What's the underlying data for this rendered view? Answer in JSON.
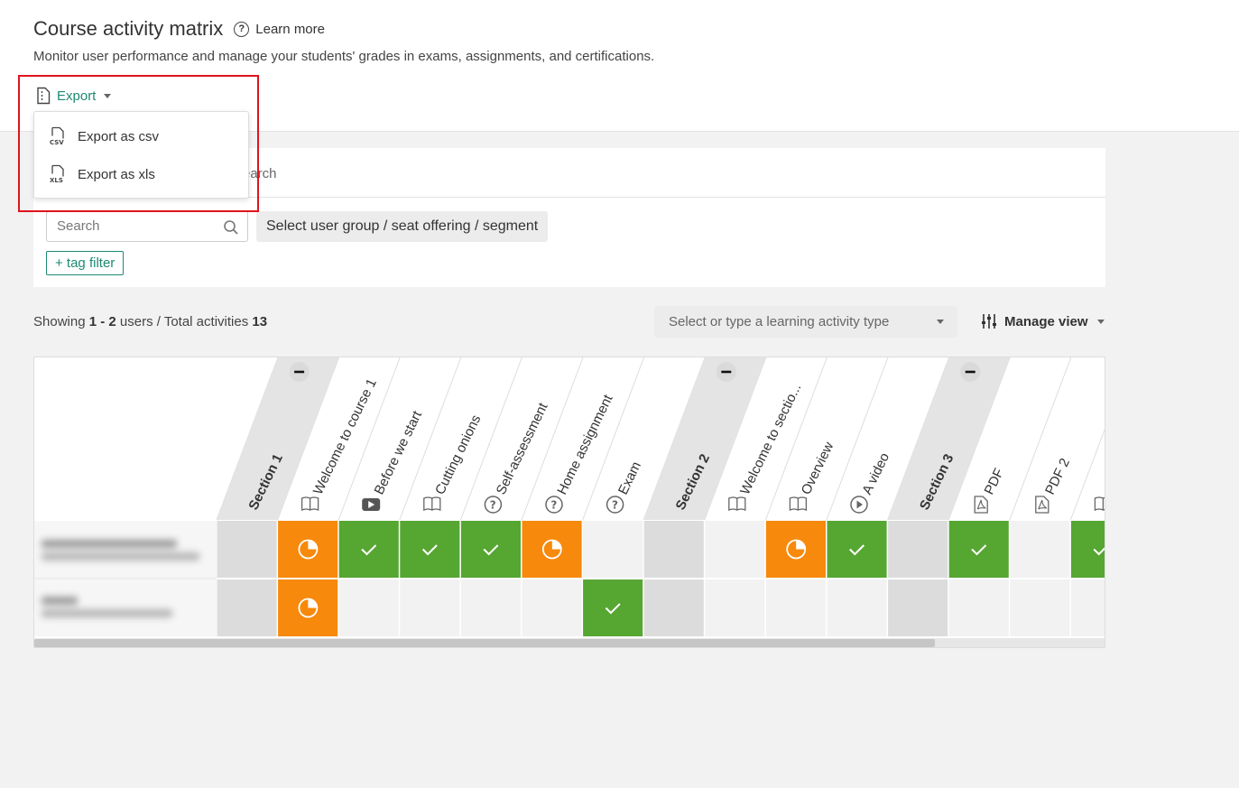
{
  "header": {
    "title": "Course activity matrix",
    "learn_more": "Learn more",
    "subtitle": "Monitor user performance and manage your students' grades in exams, assignments, and certifications."
  },
  "export": {
    "label": "Export",
    "menu": [
      {
        "label": "Export as csv",
        "icon": "csv-file-icon"
      },
      {
        "label": "Export as xls",
        "icon": "xls-file-icon"
      }
    ]
  },
  "filters": {
    "tab_partial": "earch",
    "search_placeholder": "Search",
    "group_select": "Select user group / seat offering / segment",
    "tag_filter": "+ tag filter"
  },
  "summary": {
    "showing_label": "Showing",
    "range": "1 - 2",
    "users_label": "users",
    "separator": "/ Total activities",
    "total": "13",
    "type_placeholder": "Select or type a learning activity type",
    "manage_view": "Manage view"
  },
  "colors": {
    "accent": "#1d8a74",
    "completed": "#56a632",
    "in_progress": "#f7890c",
    "section_cell": "#dcdcdc",
    "empty_cell": "#f2f2f2"
  },
  "matrix": {
    "columns": [
      {
        "type": "section",
        "label": "Section 1"
      },
      {
        "type": "activity",
        "label": "Welcome to course 1",
        "icon": "book-icon"
      },
      {
        "type": "activity",
        "label": "Before we start",
        "icon": "video-icon"
      },
      {
        "type": "activity",
        "label": "Cutting onions",
        "icon": "book-icon"
      },
      {
        "type": "activity",
        "label": "Self-assessment",
        "icon": "question-icon"
      },
      {
        "type": "activity",
        "label": "Home assignment",
        "icon": "question-icon"
      },
      {
        "type": "activity",
        "label": "Exam",
        "icon": "question-icon"
      },
      {
        "type": "section",
        "label": "Section 2"
      },
      {
        "type": "activity",
        "label": "Welcome to sectio...",
        "icon": "book-icon"
      },
      {
        "type": "activity",
        "label": "Overview",
        "icon": "book-icon"
      },
      {
        "type": "activity",
        "label": "A video",
        "icon": "play-icon"
      },
      {
        "type": "section",
        "label": "Section 3"
      },
      {
        "type": "activity",
        "label": "PDF",
        "icon": "pdf-icon"
      },
      {
        "type": "activity",
        "label": "PDF 2",
        "icon": "pdf-icon"
      },
      {
        "type": "activity",
        "label": "",
        "icon": "book-icon"
      }
    ],
    "rows": [
      [
        "section",
        "progress",
        "done",
        "done",
        "done",
        "progress",
        "empty",
        "section",
        "empty",
        "progress",
        "done",
        "section",
        "done",
        "empty",
        "done"
      ],
      [
        "section",
        "progress",
        "empty",
        "empty",
        "empty",
        "empty",
        "done",
        "section",
        "empty",
        "empty",
        "empty",
        "section",
        "empty",
        "empty",
        "empty"
      ]
    ]
  }
}
